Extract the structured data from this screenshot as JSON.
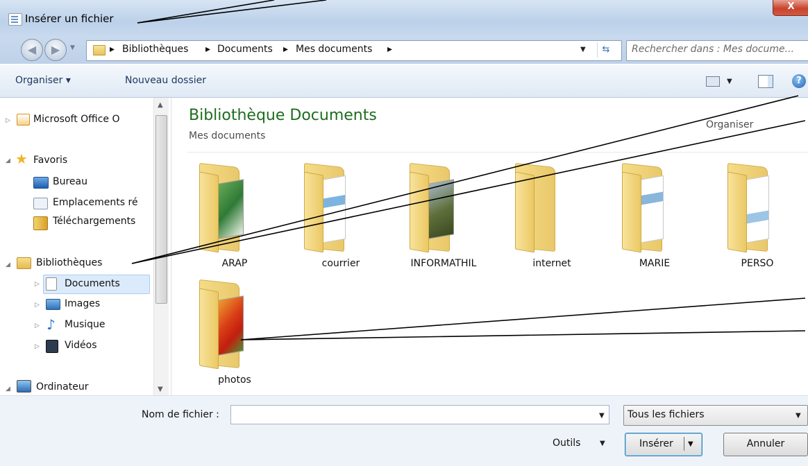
{
  "window": {
    "title": "Insérer un fichier",
    "close_label": "X"
  },
  "address": {
    "crumbs": [
      "Bibliothèques",
      "Documents",
      "Mes documents"
    ],
    "search_placeholder": "Rechercher dans : Mes docume..."
  },
  "toolbar": {
    "organize": "Organiser ▾",
    "new_folder": "Nouveau dossier"
  },
  "sidebar": {
    "items": [
      {
        "label": "Microsoft Office O",
        "icon": "outlook-icon"
      },
      {
        "label": "Favoris",
        "icon": "star-icon"
      },
      {
        "label": "Bureau",
        "icon": "desktop-icon"
      },
      {
        "label": "Emplacements ré",
        "icon": "recent-places-icon"
      },
      {
        "label": "Téléchargements",
        "icon": "downloads-icon"
      },
      {
        "label": "Bibliothèques",
        "icon": "libraries-icon"
      },
      {
        "label": "Documents",
        "icon": "documents-icon"
      },
      {
        "label": "Images",
        "icon": "pictures-icon"
      },
      {
        "label": "Musique",
        "icon": "music-icon"
      },
      {
        "label": "Vidéos",
        "icon": "videos-icon"
      },
      {
        "label": "Ordinateur",
        "icon": "computer-icon"
      }
    ]
  },
  "main": {
    "title": "Bibliothèque Documents",
    "subtitle": "Mes documents",
    "arrange_label": "Organiser",
    "folders": [
      {
        "name": "ARAP"
      },
      {
        "name": "courrier"
      },
      {
        "name": "INFORMATHIL"
      },
      {
        "name": "internet"
      },
      {
        "name": "MARIE"
      },
      {
        "name": "PERSO"
      },
      {
        "name": "photos"
      }
    ]
  },
  "footer": {
    "filename_label": "Nom de fichier :",
    "filename_value": "",
    "filetype_value": "Tous les fichiers",
    "tools_label": "Outils",
    "insert_label": "Insérer",
    "cancel_label": "Annuler"
  }
}
